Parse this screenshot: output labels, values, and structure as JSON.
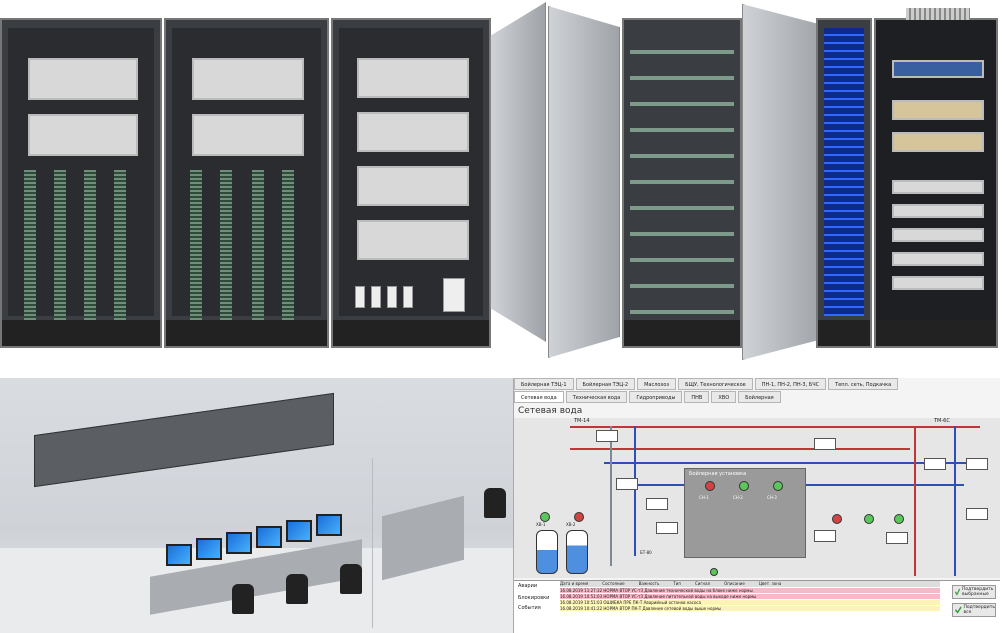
{
  "scada": {
    "tabs_top": [
      "Бойлерная ТЭЦ-1",
      "Бойлерная ТЭЦ-2",
      "Маслохоз",
      "БЩУ, Технологическое",
      "ПН-1, ПН-2, ПН-3, БЧС",
      "Тепл. сеть, Подкачка"
    ],
    "tabs_second": [
      "Сетевая вода",
      "Техническая вода",
      "Гидроприводы",
      "ПНВ",
      "ХВО",
      "Бойлерная"
    ],
    "screen_title": "Сетевая вода",
    "labels": {
      "tm14": "ТМ-14",
      "tm6": "ТМ-6С",
      "boiler": "Бойлерная установка",
      "fw1": "ХВ-1",
      "fw2": "ХВ-2",
      "bt": "БТ-80",
      "cn1": "СН-1",
      "cn2": "СН-2",
      "cn3": "СН-3"
    },
    "alarm_header": [
      "Дата и время",
      "Состояние",
      "Важность",
      "Тип",
      "Сигнал",
      "Описание",
      "Цвет. зона"
    ],
    "alarms_label": "Аварии",
    "notifications_label": "Блокировки",
    "events_label": "События",
    "ack_buttons": [
      "Подтвердить выбранные",
      "Подтвердить все"
    ],
    "alarm_rows": [
      "16.08.2019 11:27:32  НОРМА  ВТОР  УС-тЗ  Давление технической воды на блоке ниже нормы",
      "16.08.2019 10:51:03  НОРМА  ВТОР  УС-тЗ  Давление питательной воды на выходе ниже нормы",
      "16.08.2019 10:51:03  ОШИБКА  ПРЕ  ПК-Т  Аварийный останов насоса",
      "16.08.2019 10:41:22  НОРМА  ВТОР  ПК-Т  Давление сетевой воды выше нормы"
    ]
  },
  "colors": {
    "hot_pipe": "#c0353a",
    "cold_pipe": "#2f4fb5",
    "aux_pipe": "#7a8a99",
    "pump_green": "#5bc75b",
    "pump_red": "#d24444",
    "alarm_red": "#f5b9c8",
    "alarm_yellow": "#fbf3b8",
    "monitor": "#1d6fd8"
  }
}
